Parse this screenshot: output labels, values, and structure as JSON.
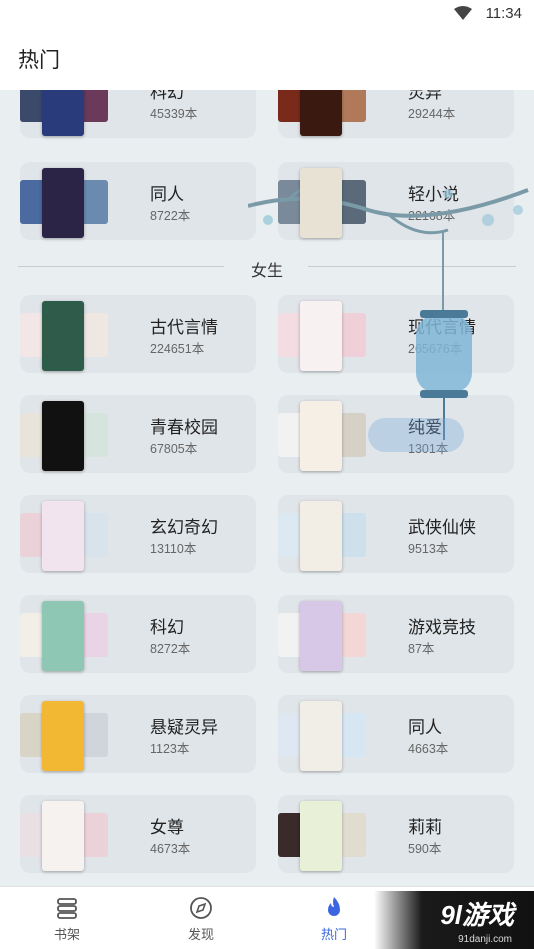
{
  "status_bar": {
    "time": "11:34"
  },
  "header": {
    "title": "热门"
  },
  "male_categories_partial": [
    {
      "name": "科幻",
      "count": "45339本",
      "covers": [
        "#3b4a6b",
        "#2a3b7c",
        "#6b3a5a"
      ]
    },
    {
      "name": "灵异",
      "count": "29244本",
      "covers": [
        "#7a2a1a",
        "#3a1a10",
        "#b07a5a"
      ]
    },
    {
      "name": "同人",
      "count": "8722本",
      "covers": [
        "#4a6aa0",
        "#2b2447",
        "#6a8ab0"
      ]
    },
    {
      "name": "轻小说",
      "count": "22168本",
      "covers": [
        "#7a8a9a",
        "#e8e2d5",
        "#5a6a7a"
      ]
    }
  ],
  "section": {
    "label": "女生"
  },
  "female_categories": [
    {
      "name": "古代言情",
      "count": "224651本",
      "covers": [
        "#f2e6e6",
        "#2f5c4a",
        "#efe7e2"
      ]
    },
    {
      "name": "现代言情",
      "count": "265676本",
      "covers": [
        "#f3dde3",
        "#f7f1f2",
        "#f0d0d8"
      ]
    },
    {
      "name": "青春校园",
      "count": "67805本",
      "covers": [
        "#e8e4dc",
        "#111111",
        "#d5e4dc"
      ]
    },
    {
      "name": "纯爱",
      "count": "1301本",
      "covers": [
        "#f2f2f2",
        "#f5efe6",
        "#d6d1c6"
      ]
    },
    {
      "name": "玄幻奇幻",
      "count": "13110本",
      "covers": [
        "#ead2d8",
        "#f1e4ee",
        "#d9e3ec"
      ]
    },
    {
      "name": "武侠仙侠",
      "count": "9513本",
      "covers": [
        "#dce8f2",
        "#f2eee6",
        "#cde0ec"
      ]
    },
    {
      "name": "科幻",
      "count": "8272本",
      "covers": [
        "#f1efe8",
        "#8fc7b5",
        "#e8d4e4"
      ]
    },
    {
      "name": "游戏竞技",
      "count": "87本",
      "covers": [
        "#f2f2f2",
        "#d8c8e8",
        "#f3d6d6"
      ]
    },
    {
      "name": "悬疑灵异",
      "count": "1123本",
      "covers": [
        "#d8d4c6",
        "#f3b833",
        "#cfd5da"
      ]
    },
    {
      "name": "同人",
      "count": "4663本",
      "covers": [
        "#dfe7f2",
        "#f0eee6",
        "#d7e6f3"
      ]
    },
    {
      "name": "女尊",
      "count": "4673本",
      "covers": [
        "#e9e0e4",
        "#f5f2f0",
        "#ebd2d8"
      ]
    },
    {
      "name": "莉莉",
      "count": "590本",
      "covers": [
        "#3a2a2a",
        "#e8f0d8",
        "#e0dccf"
      ]
    }
  ],
  "tabs": [
    {
      "label": "书架",
      "icon": "bookshelf-icon"
    },
    {
      "label": "发现",
      "icon": "compass-icon"
    },
    {
      "label": "热门",
      "icon": "flame-icon",
      "active": true
    }
  ],
  "watermark": {
    "text": "9l游戏",
    "sub": "91danji.com"
  },
  "colors": {
    "accent": "#3b66e0",
    "card_bg": "#e0e5e9",
    "content_bg": "#e9eef1"
  }
}
